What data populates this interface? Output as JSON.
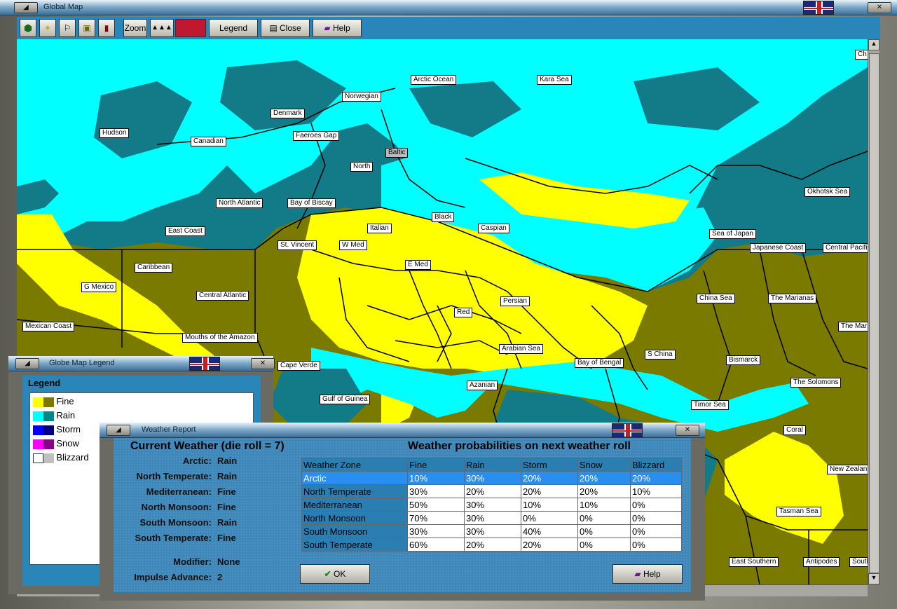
{
  "main_window": {
    "title": "Global Map"
  },
  "toolbar": {
    "zoom_label": "Zoom",
    "legend_label": "Legend",
    "close_label": "Close",
    "help_label": "Help"
  },
  "map": {
    "labels": [
      "Arctic Ocean",
      "Kara Sea",
      "Norwegian",
      "Denmark",
      "Hudson",
      "Canadian",
      "Faeroes Gap",
      "Baltic",
      "North",
      "North Atlantic",
      "Bay of Biscay",
      "Black",
      "Okhotsk Sea",
      "East Coast",
      "Italian",
      "Caspian",
      "Sea of Japan",
      "St. Vincent",
      "W Med",
      "Japanese Coast",
      "Central Pacific",
      "Caribbean",
      "E Med",
      "G Mexico",
      "Central Atlantic",
      "Persian",
      "China Sea",
      "The Marianas",
      "Red",
      "Mexican Coast",
      "Mouths of the Amazon",
      "Arabian Sea",
      "S China",
      "Bismarck",
      "Bay of Bengal",
      "Cape Verde",
      "Azanian",
      "The Solomons",
      "Gulf of Guinea",
      "Timor Sea",
      "Coral",
      "New Zealand",
      "Tasman Sea",
      "East Southern",
      "Antipodes",
      "Southern",
      "The Marianas",
      "Ch"
    ]
  },
  "legend_window": {
    "title": "Globe Map Legend",
    "heading": "Legend",
    "items": [
      {
        "label": "Fine",
        "c1": "#ffff00",
        "c2": "#7a7a00"
      },
      {
        "label": "Rain",
        "c1": "#00ffff",
        "c2": "#008888"
      },
      {
        "label": "Storm",
        "c1": "#0000ff",
        "c2": "#000080"
      },
      {
        "label": "Snow",
        "c1": "#ff00ff",
        "c2": "#880088"
      },
      {
        "label": "Blizzard",
        "c1": "#ffffff",
        "c2": "#c0c0c0"
      }
    ]
  },
  "weather_window": {
    "title": "Weather Report",
    "current_heading": "Current Weather (die roll = 7)",
    "prob_heading": "Weather probabilities on next weather roll",
    "current": [
      {
        "zone": "Arctic:",
        "value": "Rain"
      },
      {
        "zone": "North Temperate:",
        "value": "Rain"
      },
      {
        "zone": "Mediterranean:",
        "value": "Fine"
      },
      {
        "zone": "North Monsoon:",
        "value": "Fine"
      },
      {
        "zone": "South Monsoon:",
        "value": "Rain"
      },
      {
        "zone": "South Temperate:",
        "value": "Fine"
      }
    ],
    "modifier_label": "Modifier:",
    "modifier_value": "None",
    "impulse_label": "Impulse Advance:",
    "impulse_value": "2",
    "table_headers": [
      "Weather Zone",
      "Fine",
      "Rain",
      "Storm",
      "Snow",
      "Blizzard"
    ],
    "table_rows": [
      [
        "Arctic",
        "10%",
        "30%",
        "20%",
        "20%",
        "20%"
      ],
      [
        "North Temperate",
        "30%",
        "20%",
        "20%",
        "20%",
        "10%"
      ],
      [
        "Mediterranean",
        "50%",
        "30%",
        "10%",
        "10%",
        "0%"
      ],
      [
        "North Monsoon",
        "70%",
        "30%",
        "0%",
        "0%",
        "0%"
      ],
      [
        "South Monsoon",
        "30%",
        "30%",
        "40%",
        "0%",
        "0%"
      ],
      [
        "South Temperate",
        "60%",
        "20%",
        "20%",
        "0%",
        "0%"
      ]
    ],
    "ok_label": "OK",
    "help_label": "Help"
  }
}
